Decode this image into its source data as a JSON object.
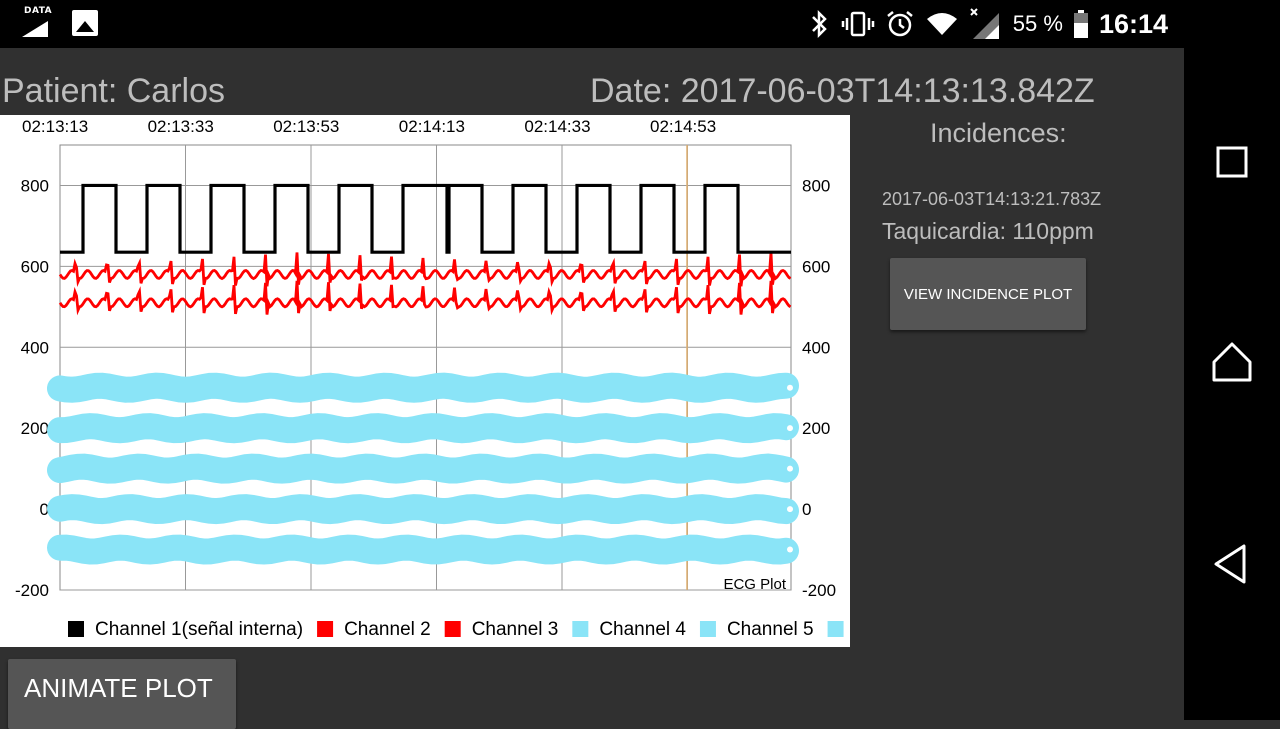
{
  "status_bar": {
    "data_label": "DATA",
    "battery_percent": "55 %",
    "time": "16:14",
    "icons": [
      "data-icon",
      "image-icon",
      "bluetooth-icon",
      "vibrate-icon",
      "alarm-icon",
      "wifi-icon",
      "signal-icon",
      "battery-icon"
    ]
  },
  "header": {
    "patient": "Patient: Carlos",
    "date": "Date: 2017-06-03T14:13:13.842Z"
  },
  "incidences": {
    "title": "Incidences:",
    "items": [
      {
        "date": "2017-06-03T14:13:21.783Z",
        "description": "Taquicardia: 110ppm"
      }
    ],
    "button_label": "VIEW INCIDENCE PLOT"
  },
  "animate_button": "ANIMATE PLOT",
  "chart_data": {
    "type": "line",
    "title": "ECG Plot",
    "top_time_labels": [
      "02:13:13",
      "02:13:33",
      "02:13:53",
      "02:14:13",
      "02:14:33",
      "02:14:53"
    ],
    "y_ticks": [
      800,
      600,
      400,
      200,
      0,
      -200
    ],
    "ylim": [
      -200,
      900
    ],
    "grid": true,
    "legend_position": "bottom",
    "series": [
      {
        "name": "Channel 1(señal interna)",
        "color": "#000000",
        "shape": "square-wave",
        "low": 635,
        "high": 800
      },
      {
        "name": "Channel 2",
        "color": "#ff0000",
        "shape": "ecg",
        "baseline": 580,
        "amplitude": 20
      },
      {
        "name": "Channel 3",
        "color": "#ff0000",
        "shape": "ecg",
        "baseline": 510,
        "amplitude": 20
      },
      {
        "name": "Channel 4",
        "color": "#8ae4f7",
        "values": [
          300,
          200,
          100,
          0,
          -100
        ]
      },
      {
        "name": "Channel 5",
        "color": "#8ae4f7",
        "values": [
          300,
          200,
          100,
          0,
          -100
        ]
      }
    ]
  },
  "nav": [
    "recents-icon",
    "home-icon",
    "back-icon"
  ]
}
